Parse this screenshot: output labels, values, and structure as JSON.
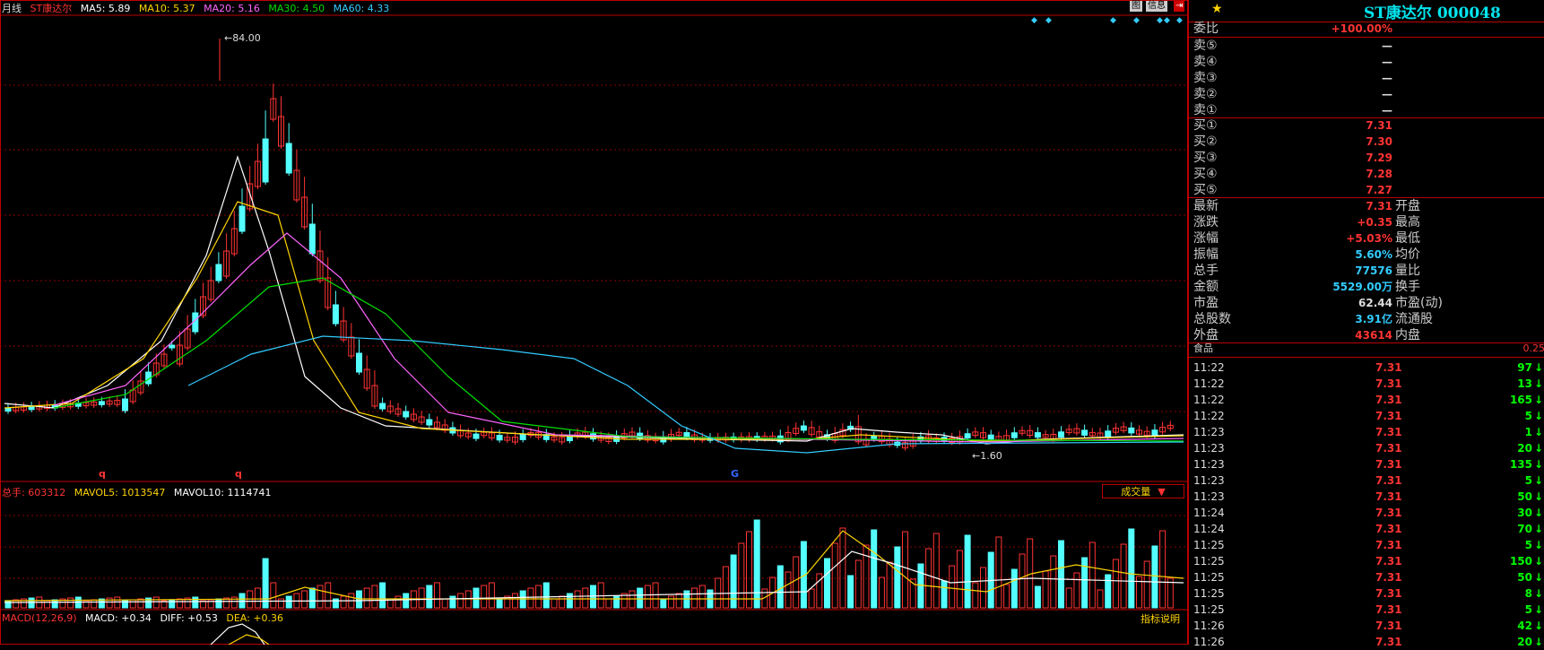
{
  "header": {
    "period": "月线",
    "stock_name": "ST康达尔",
    "ma": [
      {
        "label": "MA5: 5.89",
        "color": "#ffffff"
      },
      {
        "label": "MA10: 5.37",
        "color": "#ffd400"
      },
      {
        "label": "MA20: 5.16",
        "color": "#ff66ff"
      },
      {
        "label": "MA30: 4.50",
        "color": "#00dd00"
      },
      {
        "label": "MA60: 4.33",
        "color": "#33ccff"
      }
    ]
  },
  "price_chart": {
    "high_label": "84.00",
    "low_label": "1.60",
    "markers": [
      "q",
      "q",
      "G"
    ]
  },
  "volume": {
    "legend": [
      "总手: 603312",
      "MAVOL5: 1013547",
      "MAVOL10: 1114741"
    ],
    "selector_label": "成交量",
    "selector_arrow": "▼"
  },
  "macd": {
    "legend": [
      "MACD(12,26,9)",
      "MACD: +0.34",
      "DIFF: +0.53",
      "DEA: +0.36"
    ],
    "help_label": "指标说明"
  },
  "panel": {
    "title": "ST康达尔 000048",
    "toolbar": [
      "图",
      "信息",
      "⇥"
    ],
    "weibi_label": "委比",
    "weibi_value": "+100.00%",
    "sell": [
      {
        "label": "卖⑤",
        "price": "—"
      },
      {
        "label": "卖④",
        "price": "—"
      },
      {
        "label": "卖③",
        "price": "—"
      },
      {
        "label": "卖②",
        "price": "—"
      },
      {
        "label": "卖①",
        "price": "—"
      }
    ],
    "buy": [
      {
        "label": "买①",
        "price": "7.31"
      },
      {
        "label": "买②",
        "price": "7.30"
      },
      {
        "label": "买③",
        "price": "7.29"
      },
      {
        "label": "买④",
        "price": "7.28"
      },
      {
        "label": "买⑤",
        "price": "7.27"
      }
    ],
    "stats": [
      {
        "label": "最新",
        "value": "7.31",
        "color": "#ff3333",
        "label2": "开盘"
      },
      {
        "label": "涨跌",
        "value": "+0.35",
        "color": "#ff3333",
        "label2": "最高"
      },
      {
        "label": "涨幅",
        "value": "+5.03%",
        "color": "#ff3333",
        "label2": "最低"
      },
      {
        "label": "振幅",
        "value": "5.60%",
        "color": "#33ccff",
        "label2": "均价"
      },
      {
        "label": "总手",
        "value": "77576",
        "color": "#33ccff",
        "label2": "量比"
      },
      {
        "label": "金额",
        "value": "5529.00万",
        "color": "#33ccff",
        "label2": "换手"
      },
      {
        "label": "市盈",
        "value": "62.44",
        "color": "#dddddd",
        "label2": "市盈(动)"
      },
      {
        "label": "总股数",
        "value": "3.91亿",
        "color": "#33ccff",
        "label2": "流通股"
      },
      {
        "label": "外盘",
        "value": "43614",
        "color": "#ff3333",
        "label2": "内盘"
      }
    ],
    "sector_label": "食品",
    "sector_value": "0.25",
    "ticks": [
      {
        "time": "11:22",
        "price": "7.31",
        "vol": "97"
      },
      {
        "time": "11:22",
        "price": "7.31",
        "vol": "13"
      },
      {
        "time": "11:22",
        "price": "7.31",
        "vol": "165"
      },
      {
        "time": "11:22",
        "price": "7.31",
        "vol": "5"
      },
      {
        "time": "11:23",
        "price": "7.31",
        "vol": "1"
      },
      {
        "time": "11:23",
        "price": "7.31",
        "vol": "20"
      },
      {
        "time": "11:23",
        "price": "7.31",
        "vol": "135"
      },
      {
        "time": "11:23",
        "price": "7.31",
        "vol": "5"
      },
      {
        "time": "11:23",
        "price": "7.31",
        "vol": "50"
      },
      {
        "time": "11:24",
        "price": "7.31",
        "vol": "30"
      },
      {
        "time": "11:24",
        "price": "7.31",
        "vol": "70"
      },
      {
        "time": "11:25",
        "price": "7.31",
        "vol": "5"
      },
      {
        "time": "11:25",
        "price": "7.31",
        "vol": "150"
      },
      {
        "time": "11:25",
        "price": "7.31",
        "vol": "50"
      },
      {
        "time": "11:25",
        "price": "7.31",
        "vol": "8"
      },
      {
        "time": "11:25",
        "price": "7.31",
        "vol": "5"
      },
      {
        "time": "11:26",
        "price": "7.31",
        "vol": "42"
      },
      {
        "time": "11:26",
        "price": "7.31",
        "vol": "20"
      }
    ]
  }
}
